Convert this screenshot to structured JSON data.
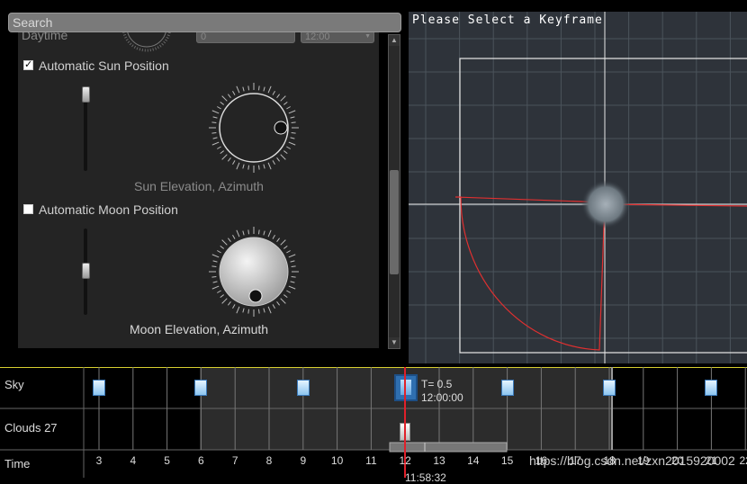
{
  "search": {
    "placeholder": "Search"
  },
  "panel": {
    "daytime_label": "Daytime",
    "daytime_value": "0",
    "daytime_time": "12:00",
    "sun": {
      "checkbox_label": "Automatic Sun Position",
      "checked": true,
      "caption": "Sun Elevation, Azimuth"
    },
    "moon": {
      "checkbox_label": "Automatic Moon Position",
      "checked": false,
      "caption": "Moon Elevation, Azimuth"
    }
  },
  "viewport": {
    "title": "Please Select a Keyframe"
  },
  "timeline": {
    "tracks": [
      {
        "label": "Sky"
      },
      {
        "label": "Clouds 27"
      },
      {
        "label": "Time"
      }
    ],
    "selected_key": {
      "t_label": "T= 0.5",
      "time_label": "12:00:00"
    },
    "current_time": "11:58:32",
    "ticks": [
      "3",
      "4",
      "5",
      "6",
      "7",
      "8",
      "9",
      "10",
      "11",
      "12",
      "13",
      "14",
      "15",
      "16",
      "17",
      "18",
      "19",
      "20",
      "21",
      "22"
    ],
    "watermark": "https://blog.csdn.net/zxn2015920002"
  },
  "colors": {
    "accent": "#3a78b8",
    "playhead": "#e0202a",
    "curve": "#e03030"
  }
}
